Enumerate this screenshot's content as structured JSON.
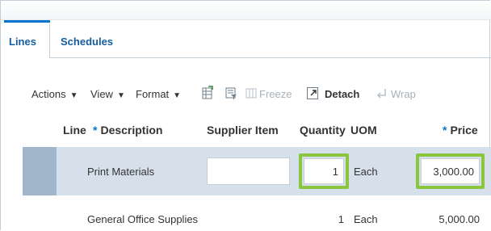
{
  "tabs": [
    {
      "label": "Lines",
      "active": true
    },
    {
      "label": "Schedules",
      "active": false
    }
  ],
  "toolbar": {
    "actions_label": "Actions",
    "view_label": "View",
    "format_label": "Format",
    "dropdown_glyph": "▼",
    "freeze_label": "Freeze",
    "detach_label": "Detach",
    "wrap_label": "Wrap",
    "icons": [
      "export-icon",
      "query-by-example-icon",
      "freeze-icon",
      "detach-icon",
      "wrap-icon"
    ]
  },
  "table": {
    "columns": {
      "line": "Line",
      "description": "Description",
      "supplier_item": "Supplier Item",
      "quantity": "Quantity",
      "uom": "UOM",
      "price": "Price",
      "required_marker": "*"
    },
    "rows": [
      {
        "line": "",
        "description": "Print Materials",
        "supplier_item": "",
        "quantity": "1",
        "uom": "Each",
        "price": "3,000.00",
        "selected": true
      },
      {
        "line": "",
        "description": "General Office Supplies",
        "supplier_item": "",
        "quantity": "1",
        "uom": "Each",
        "price": "5,000.00",
        "selected": false
      }
    ]
  },
  "colors": {
    "accent": "#0572ce",
    "selected_row": "#d6e0ea",
    "highlight": "#8cc63f",
    "tab_text": "#145c9e"
  }
}
